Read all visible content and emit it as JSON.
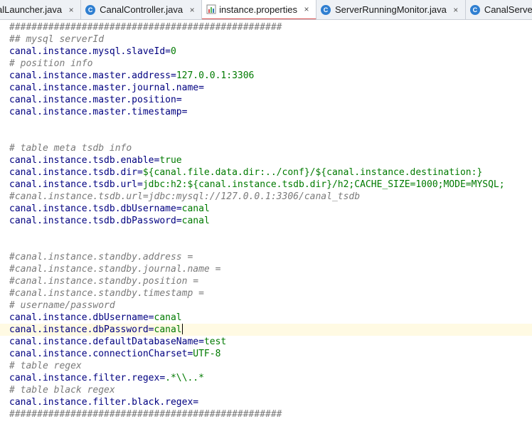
{
  "tabs": [
    {
      "label": "alLauncher.java",
      "icon": "java-class-icon",
      "active": false,
      "closable": true
    },
    {
      "label": "CanalController.java",
      "icon": "java-class-icon",
      "active": false,
      "closable": true
    },
    {
      "label": "instance.properties",
      "icon": "properties-file-icon",
      "active": true,
      "closable": true
    },
    {
      "label": "ServerRunningMonitor.java",
      "icon": "java-class-icon",
      "active": false,
      "closable": true
    },
    {
      "label": "CanalServerW",
      "icon": "java-class-icon",
      "active": false,
      "closable": false
    }
  ],
  "tab_icon_letter": "C",
  "close_glyph": "×",
  "editor": {
    "lines": [
      {
        "type": "comment",
        "text": "#################################################"
      },
      {
        "type": "comment",
        "text": "## mysql serverId"
      },
      {
        "type": "prop",
        "key": "canal.instance.mysql.slaveId",
        "value": "0"
      },
      {
        "type": "comment",
        "text": "# position info"
      },
      {
        "type": "prop",
        "key": "canal.instance.master.address",
        "value": "127.0.0.1:3306"
      },
      {
        "type": "prop",
        "key": "canal.instance.master.journal.name",
        "value": ""
      },
      {
        "type": "prop",
        "key": "canal.instance.master.position",
        "value": ""
      },
      {
        "type": "prop",
        "key": "canal.instance.master.timestamp",
        "value": ""
      },
      {
        "type": "blank"
      },
      {
        "type": "blank"
      },
      {
        "type": "comment",
        "text": "# table meta tsdb info"
      },
      {
        "type": "prop",
        "key": "canal.instance.tsdb.enable",
        "value": "true"
      },
      {
        "type": "prop",
        "key": "canal.instance.tsdb.dir",
        "value": "${canal.file.data.dir:../conf}/${canal.instance.destination:}"
      },
      {
        "type": "prop",
        "key": "canal.instance.tsdb.url",
        "value": "jdbc:h2:${canal.instance.tsdb.dir}/h2;CACHE_SIZE=1000;MODE=MYSQL;"
      },
      {
        "type": "comment",
        "text": "#canal.instance.tsdb.url=jdbc:mysql://127.0.0.1:3306/canal_tsdb"
      },
      {
        "type": "prop",
        "key": "canal.instance.tsdb.dbUsername",
        "value": "canal"
      },
      {
        "type": "prop",
        "key": "canal.instance.tsdb.dbPassword",
        "value": "canal"
      },
      {
        "type": "blank"
      },
      {
        "type": "blank"
      },
      {
        "type": "comment",
        "text": "#canal.instance.standby.address ="
      },
      {
        "type": "comment",
        "text": "#canal.instance.standby.journal.name ="
      },
      {
        "type": "comment",
        "text": "#canal.instance.standby.position ="
      },
      {
        "type": "comment",
        "text": "#canal.instance.standby.timestamp ="
      },
      {
        "type": "comment",
        "text": "# username/password"
      },
      {
        "type": "prop",
        "key": "canal.instance.dbUsername",
        "value": "canal"
      },
      {
        "type": "prop",
        "key": "canal.instance.dbPassword",
        "value": "canal",
        "current": true
      },
      {
        "type": "prop",
        "key": "canal.instance.defaultDatabaseName",
        "value": "test"
      },
      {
        "type": "prop",
        "key": "canal.instance.connectionCharset",
        "value": "UTF-8"
      },
      {
        "type": "comment",
        "text": "# table regex"
      },
      {
        "type": "prop",
        "key": "canal.instance.filter.regex",
        "value": ".*\\\\..*"
      },
      {
        "type": "comment",
        "text": "# table black regex"
      },
      {
        "type": "prop",
        "key": "canal.instance.filter.black.regex",
        "value": ""
      },
      {
        "type": "comment",
        "text": "#################################################"
      }
    ]
  },
  "colors": {
    "comment": "#7a7a7a",
    "key": "#000080",
    "value": "#007a00",
    "current_line": "#fffae3",
    "active_tab_underline": "#d64a4a",
    "java_icon": "#2f7fd1"
  }
}
